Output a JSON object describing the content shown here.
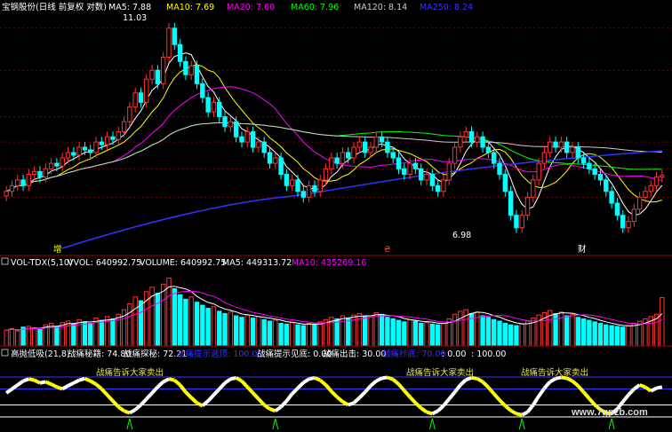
{
  "header": {
    "title": "宝钢股份(日线 前复权 对数)",
    "ma_labels": [
      {
        "text": "MA5: 7.88",
        "color": "#ffffff"
      },
      {
        "text": "MA10: 7.69",
        "color": "#ffff00"
      },
      {
        "text": "MA20: 7.60",
        "color": "#ff00ff"
      },
      {
        "text": "MA60: 7.96",
        "color": "#00ff00"
      },
      {
        "text": "MA120: 8.14",
        "color": "#cccccc"
      },
      {
        "text": "MA250: 8.24",
        "color": "#3333ff"
      }
    ]
  },
  "annotations": {
    "high": "11.03",
    "low": "6.98",
    "marks": [
      {
        "text": "增",
        "color": "#ffff00"
      },
      {
        "text": "₴",
        "color": "#ff3333"
      },
      {
        "text": "财",
        "color": "#ffffff"
      }
    ]
  },
  "vol_header": {
    "title": "VOL-TDX(5,10)",
    "items": [
      {
        "text": "VVOL: 640992.75",
        "color": "#ffffff"
      },
      {
        "text": "VOLUME: 640992.75",
        "color": "#ffffff"
      },
      {
        "text": "MA5: 449313.72",
        "color": "#ffffff"
      },
      {
        "text": "MA10: 435269.16",
        "color": "#ff00ff"
      }
    ]
  },
  "ind_header": {
    "title": "高抛低吸(21,8)",
    "items": [
      {
        "text": "战痛秘籍: 74.80",
        "color": "#ffffff"
      },
      {
        "text": "战痛探秘: 72.21",
        "color": "#ffffff"
      },
      {
        "text": "战痛提示逃顶: 100.00",
        "color": "#3333ff"
      },
      {
        "text": "战痛提示见底: 0.00",
        "color": "#ffffff"
      },
      {
        "text": "战痛出击: 30.00",
        "color": "#ffffff"
      },
      {
        "text": "战痛抄底: 70.00",
        "color": "#3333ff"
      },
      {
        "text": ": 0.00",
        "color": "#ffffff"
      },
      {
        "text": ": 100.00",
        "color": "#ffffff"
      }
    ]
  },
  "signals": [
    {
      "text": "战痛告诉大家卖出"
    },
    {
      "text": "战痛告诉大家卖出"
    },
    {
      "text": "战痛告诉大家卖出"
    }
  ],
  "watermark": "www.7gpzb.com",
  "colors": {
    "up": "#ff3333",
    "down": "#00ffff",
    "ma5": "#ffffff",
    "ma10": "#ffff00",
    "ma20": "#ff00ff",
    "ma60": "#00ff00",
    "ma120": "#cccccc",
    "ma250": "#3333ff",
    "grid": "#7a0000"
  },
  "chart_data": {
    "type": "candlestick",
    "price_scale": "log",
    "ylim": [
      6.6,
      11.4
    ],
    "close": [
      7.6,
      7.7,
      7.8,
      7.7,
      7.9,
      7.95,
      7.85,
      8.0,
      8.1,
      8.05,
      8.2,
      8.3,
      8.25,
      8.4,
      8.35,
      8.3,
      8.5,
      8.45,
      8.6,
      8.55,
      8.7,
      8.9,
      9.2,
      9.5,
      9.3,
      9.8,
      10.0,
      9.7,
      10.3,
      11.0,
      10.6,
      10.2,
      9.9,
      10.1,
      9.7,
      9.4,
      9.1,
      9.3,
      9.0,
      8.8,
      8.9,
      8.6,
      8.5,
      8.7,
      8.4,
      8.5,
      8.3,
      8.1,
      8.2,
      7.9,
      7.7,
      7.8,
      7.6,
      7.5,
      7.7,
      7.6,
      7.8,
      8.0,
      8.2,
      8.1,
      8.3,
      8.2,
      8.4,
      8.5,
      8.3,
      8.4,
      8.6,
      8.5,
      8.3,
      8.2,
      8.0,
      7.9,
      8.1,
      8.0,
      7.8,
      7.9,
      7.7,
      7.6,
      7.8,
      8.1,
      8.4,
      8.6,
      8.7,
      8.5,
      8.6,
      8.4,
      8.3,
      8.1,
      7.9,
      7.6,
      7.2,
      7.0,
      7.2,
      7.5,
      7.8,
      8.1,
      8.3,
      8.5,
      8.4,
      8.5,
      8.3,
      8.4,
      8.2,
      8.1,
      8.0,
      7.9,
      7.8,
      7.6,
      7.4,
      7.2,
      7.0,
      7.1,
      7.3,
      7.5,
      7.6,
      7.7,
      7.85,
      7.88
    ],
    "volume_ylim": [
      0,
      1000000
    ],
    "volume": [
      210000,
      230000,
      200000,
      250000,
      260000,
      240000,
      220000,
      280000,
      300000,
      260000,
      310000,
      330000,
      290000,
      350000,
      320000,
      300000,
      370000,
      340000,
      390000,
      360000,
      420000,
      480000,
      560000,
      650000,
      600000,
      720000,
      780000,
      700000,
      820000,
      900000,
      760000,
      680000,
      620000,
      650000,
      580000,
      540000,
      500000,
      520000,
      460000,
      430000,
      450000,
      400000,
      380000,
      410000,
      370000,
      390000,
      350000,
      330000,
      340000,
      300000,
      290000,
      310000,
      280000,
      270000,
      300000,
      290000,
      320000,
      350000,
      380000,
      360000,
      400000,
      370000,
      410000,
      430000,
      390000,
      400000,
      440000,
      420000,
      380000,
      360000,
      340000,
      320000,
      350000,
      330000,
      300000,
      310000,
      290000,
      280000,
      300000,
      360000,
      420000,
      460000,
      480000,
      430000,
      450000,
      400000,
      380000,
      350000,
      330000,
      300000,
      280000,
      270000,
      290000,
      330000,
      370000,
      410000,
      440000,
      470000,
      430000,
      450000,
      400000,
      420000,
      380000,
      360000,
      340000,
      320000,
      300000,
      280000,
      270000,
      260000,
      250000,
      270000,
      300000,
      330000,
      360000,
      390000,
      420000,
      640992.75
    ],
    "indicator_ylim": [
      0,
      100
    ],
    "indicator": [
      60,
      70,
      80,
      90,
      95,
      92,
      85,
      88,
      82,
      75,
      70,
      78,
      85,
      92,
      96,
      90,
      82,
      70,
      55,
      40,
      25,
      15,
      10,
      18,
      30,
      45,
      60,
      75,
      88,
      95,
      92,
      80,
      62,
      48,
      35,
      28,
      40,
      55,
      70,
      85,
      95,
      98,
      90,
      75,
      60,
      45,
      30,
      20,
      15,
      25,
      40,
      58,
      72,
      86,
      95,
      98,
      92,
      80,
      64,
      50,
      38,
      30,
      35,
      48,
      62,
      78,
      90,
      97,
      99,
      94,
      82,
      66,
      50,
      35,
      22,
      12,
      8,
      15,
      28,
      45,
      62,
      80,
      93,
      98,
      96,
      88,
      74,
      58,
      42,
      28,
      16,
      8,
      5,
      12,
      30,
      52,
      72,
      88,
      96,
      99,
      97,
      90,
      78,
      62,
      46,
      30,
      18,
      10,
      8,
      20,
      38,
      55,
      70,
      80,
      74.8,
      65,
      72,
      74.8
    ],
    "reference_lines": [
      100,
      70,
      30,
      0
    ]
  }
}
